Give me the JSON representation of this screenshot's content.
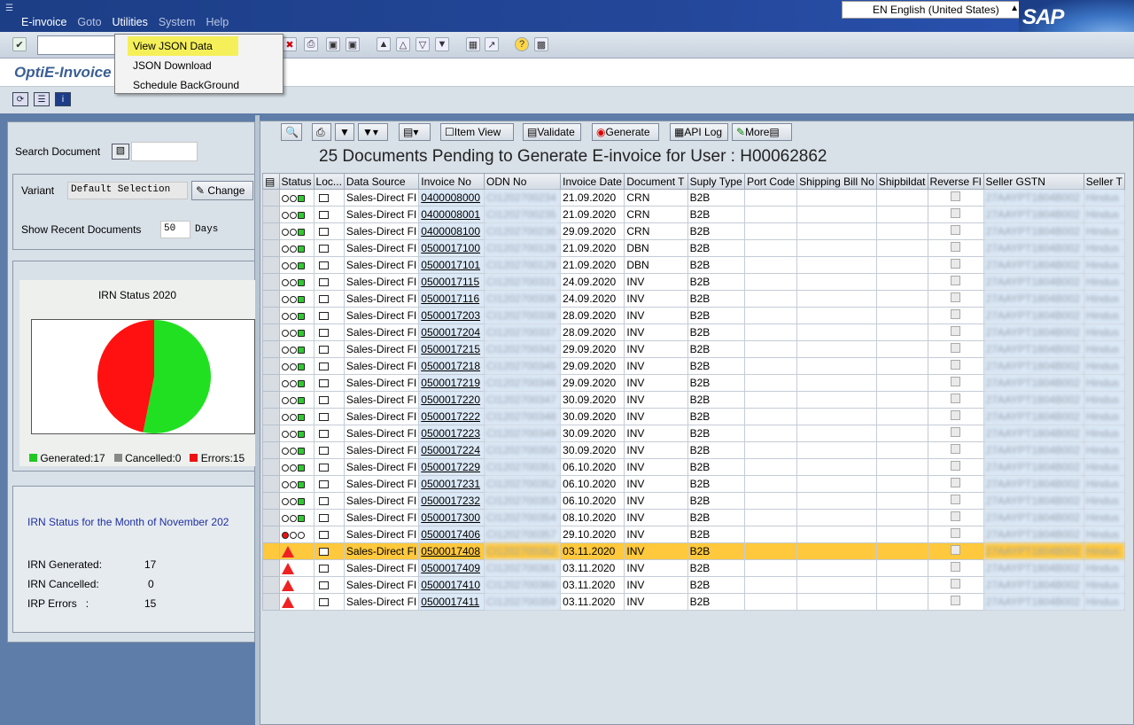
{
  "menubar": [
    "E-invoice",
    "Goto",
    "Utilities",
    "System",
    "Help"
  ],
  "language": "EN English (United States)",
  "brand": "SAP",
  "app_title": "OptiE-Invoice",
  "utilities_menu": [
    "View JSON Data",
    "JSON Download",
    "Schedule BackGround"
  ],
  "search_label": "Search Document",
  "variant_label": "Variant",
  "variant_value": "Default Selection",
  "change_label": "Change",
  "recent_label": "Show Recent Documents",
  "recent_value": "50",
  "recent_unit": "Days",
  "chart_title": "IRN Status 2020",
  "legend": [
    {
      "label": "Generated:17",
      "color": "#21c821"
    },
    {
      "label": "Cancelled:0",
      "color": "#888888"
    },
    {
      "label": "Errors:15",
      "color": "#ee1111"
    }
  ],
  "chart_data": {
    "type": "pie",
    "title": "IRN Status 2020",
    "categories": [
      "Generated",
      "Cancelled",
      "Errors"
    ],
    "values": [
      17,
      0,
      15
    ],
    "colors": [
      "#21e021",
      "#888888",
      "#ff1111"
    ]
  },
  "month_title": "IRN Status for the Month of November 202",
  "month_stats": [
    {
      "label": "IRN Generated:",
      "value": "17"
    },
    {
      "label": "IRN Cancelled:",
      "value": "0"
    },
    {
      "label": "IRP Errors   :",
      "value": "15"
    }
  ],
  "grid_buttons": [
    "Item View",
    "Validate",
    "Generate",
    "API Log",
    "More"
  ],
  "grid_title": "25 Documents Pending to Generate E-invoice for User : H00062862",
  "columns": [
    "Status",
    "Loc...",
    "Data Source",
    "Invoice No",
    "ODN No",
    "Invoice Date",
    "Document T",
    "Suply Type",
    "Port Code",
    "Shipping Bill No",
    "Shipbildat",
    "Reverse Fl",
    "Seller GSTN",
    "Seller T"
  ],
  "rows": [
    {
      "status": "ok",
      "source": "Sales-Direct FI",
      "invoice": "0400008000",
      "odn": "CI1202700234",
      "date": "21.09.2020",
      "doc": "CRN",
      "supply": "B2B",
      "gstn": "27AAYPT1804B002",
      "seller": "Hindus"
    },
    {
      "status": "ok",
      "source": "Sales-Direct FI",
      "invoice": "0400008001",
      "odn": "CI1202700235",
      "date": "21.09.2020",
      "doc": "CRN",
      "supply": "B2B",
      "gstn": "27AAYPT1804B002",
      "seller": "Hindus"
    },
    {
      "status": "ok",
      "source": "Sales-Direct FI",
      "invoice": "0400008100",
      "odn": "CI1202700236",
      "date": "29.09.2020",
      "doc": "CRN",
      "supply": "B2B",
      "gstn": "27AAYPT1804B002",
      "seller": "Hindus"
    },
    {
      "status": "ok",
      "source": "Sales-Direct FI",
      "invoice": "0500017100",
      "odn": "CI1202700128",
      "date": "21.09.2020",
      "doc": "DBN",
      "supply": "B2B",
      "gstn": "27AAYPT1804B002",
      "seller": "Hindus"
    },
    {
      "status": "ok",
      "source": "Sales-Direct FI",
      "invoice": "0500017101",
      "odn": "CI1202700129",
      "date": "21.09.2020",
      "doc": "DBN",
      "supply": "B2B",
      "gstn": "27AAYPT1804B002",
      "seller": "Hindus"
    },
    {
      "status": "ok",
      "source": "Sales-Direct FI",
      "invoice": "0500017115",
      "odn": "CI1202700331",
      "date": "24.09.2020",
      "doc": "INV",
      "supply": "B2B",
      "gstn": "27AAYPT1804B002",
      "seller": "Hindus"
    },
    {
      "status": "ok",
      "source": "Sales-Direct FI",
      "invoice": "0500017116",
      "odn": "CI1202700336",
      "date": "24.09.2020",
      "doc": "INV",
      "supply": "B2B",
      "gstn": "27AAYPT1804B002",
      "seller": "Hindus"
    },
    {
      "status": "ok",
      "source": "Sales-Direct FI",
      "invoice": "0500017203",
      "odn": "CI1202700338",
      "date": "28.09.2020",
      "doc": "INV",
      "supply": "B2B",
      "gstn": "27AAYPT1804B002",
      "seller": "Hindus"
    },
    {
      "status": "ok",
      "source": "Sales-Direct FI",
      "invoice": "0500017204",
      "odn": "CI1202700337",
      "date": "28.09.2020",
      "doc": "INV",
      "supply": "B2B",
      "gstn": "27AAYPT1804B002",
      "seller": "Hindus"
    },
    {
      "status": "ok",
      "source": "Sales-Direct FI",
      "invoice": "0500017215",
      "odn": "CI1202700342",
      "date": "29.09.2020",
      "doc": "INV",
      "supply": "B2B",
      "gstn": "27AAYPT1804B002",
      "seller": "Hindus"
    },
    {
      "status": "ok",
      "source": "Sales-Direct FI",
      "invoice": "0500017218",
      "odn": "CI1202700345",
      "date": "29.09.2020",
      "doc": "INV",
      "supply": "B2B",
      "gstn": "27AAYPT1804B002",
      "seller": "Hindus"
    },
    {
      "status": "ok",
      "source": "Sales-Direct FI",
      "invoice": "0500017219",
      "odn": "CI1202700346",
      "date": "29.09.2020",
      "doc": "INV",
      "supply": "B2B",
      "gstn": "27AAYPT1804B002",
      "seller": "Hindus"
    },
    {
      "status": "ok",
      "source": "Sales-Direct FI",
      "invoice": "0500017220",
      "odn": "CI1202700347",
      "date": "30.09.2020",
      "doc": "INV",
      "supply": "B2B",
      "gstn": "27AAYPT1804B002",
      "seller": "Hindus"
    },
    {
      "status": "ok",
      "source": "Sales-Direct FI",
      "invoice": "0500017222",
      "odn": "CI1202700348",
      "date": "30.09.2020",
      "doc": "INV",
      "supply": "B2B",
      "gstn": "27AAYPT1804B002",
      "seller": "Hindus"
    },
    {
      "status": "ok",
      "source": "Sales-Direct FI",
      "invoice": "0500017223",
      "odn": "CI1202700349",
      "date": "30.09.2020",
      "doc": "INV",
      "supply": "B2B",
      "gstn": "27AAYPT1804B002",
      "seller": "Hindus"
    },
    {
      "status": "ok",
      "source": "Sales-Direct FI",
      "invoice": "0500017224",
      "odn": "CI1202700350",
      "date": "30.09.2020",
      "doc": "INV",
      "supply": "B2B",
      "gstn": "27AAYPT1804B002",
      "seller": "Hindus"
    },
    {
      "status": "ok",
      "source": "Sales-Direct FI",
      "invoice": "0500017229",
      "odn": "CI1202700351",
      "date": "06.10.2020",
      "doc": "INV",
      "supply": "B2B",
      "gstn": "27AAYPT1804B002",
      "seller": "Hindus"
    },
    {
      "status": "ok",
      "source": "Sales-Direct FI",
      "invoice": "0500017231",
      "odn": "CI1202700352",
      "date": "06.10.2020",
      "doc": "INV",
      "supply": "B2B",
      "gstn": "27AAYPT1804B002",
      "seller": "Hindus"
    },
    {
      "status": "ok",
      "source": "Sales-Direct FI",
      "invoice": "0500017232",
      "odn": "CI1202700353",
      "date": "06.10.2020",
      "doc": "INV",
      "supply": "B2B",
      "gstn": "27AAYPT1804B002",
      "seller": "Hindus"
    },
    {
      "status": "ok",
      "source": "Sales-Direct FI",
      "invoice": "0500017300",
      "odn": "CI1202700354",
      "date": "08.10.2020",
      "doc": "INV",
      "supply": "B2B",
      "gstn": "27AAYPT1804B002",
      "seller": "Hindus"
    },
    {
      "status": "red",
      "source": "Sales-Direct FI",
      "invoice": "0500017406",
      "odn": "CI1202700357",
      "date": "29.10.2020",
      "doc": "INV",
      "supply": "B2B",
      "gstn": "27AAYPT1804B002",
      "seller": "Hindus"
    },
    {
      "status": "warn",
      "source": "Sales-Direct FI",
      "invoice": "0500017408",
      "odn": "CI1202700362",
      "date": "03.11.2020",
      "doc": "INV",
      "supply": "B2B",
      "gstn": "27AAYPT1804B002",
      "seller": "Hindus",
      "selected": true
    },
    {
      "status": "warn",
      "source": "Sales-Direct FI",
      "invoice": "0500017409",
      "odn": "CI1202700361",
      "date": "03.11.2020",
      "doc": "INV",
      "supply": "B2B",
      "gstn": "27AAYPT1804B002",
      "seller": "Hindus"
    },
    {
      "status": "warn",
      "source": "Sales-Direct FI",
      "invoice": "0500017410",
      "odn": "CI1202700360",
      "date": "03.11.2020",
      "doc": "INV",
      "supply": "B2B",
      "gstn": "27AAYPT1804B002",
      "seller": "Hindus"
    },
    {
      "status": "warn",
      "source": "Sales-Direct FI",
      "invoice": "0500017411",
      "odn": "CI1202700359",
      "date": "03.11.2020",
      "doc": "INV",
      "supply": "B2B",
      "gstn": "27AAYPT1804B002",
      "seller": "Hindus"
    }
  ]
}
